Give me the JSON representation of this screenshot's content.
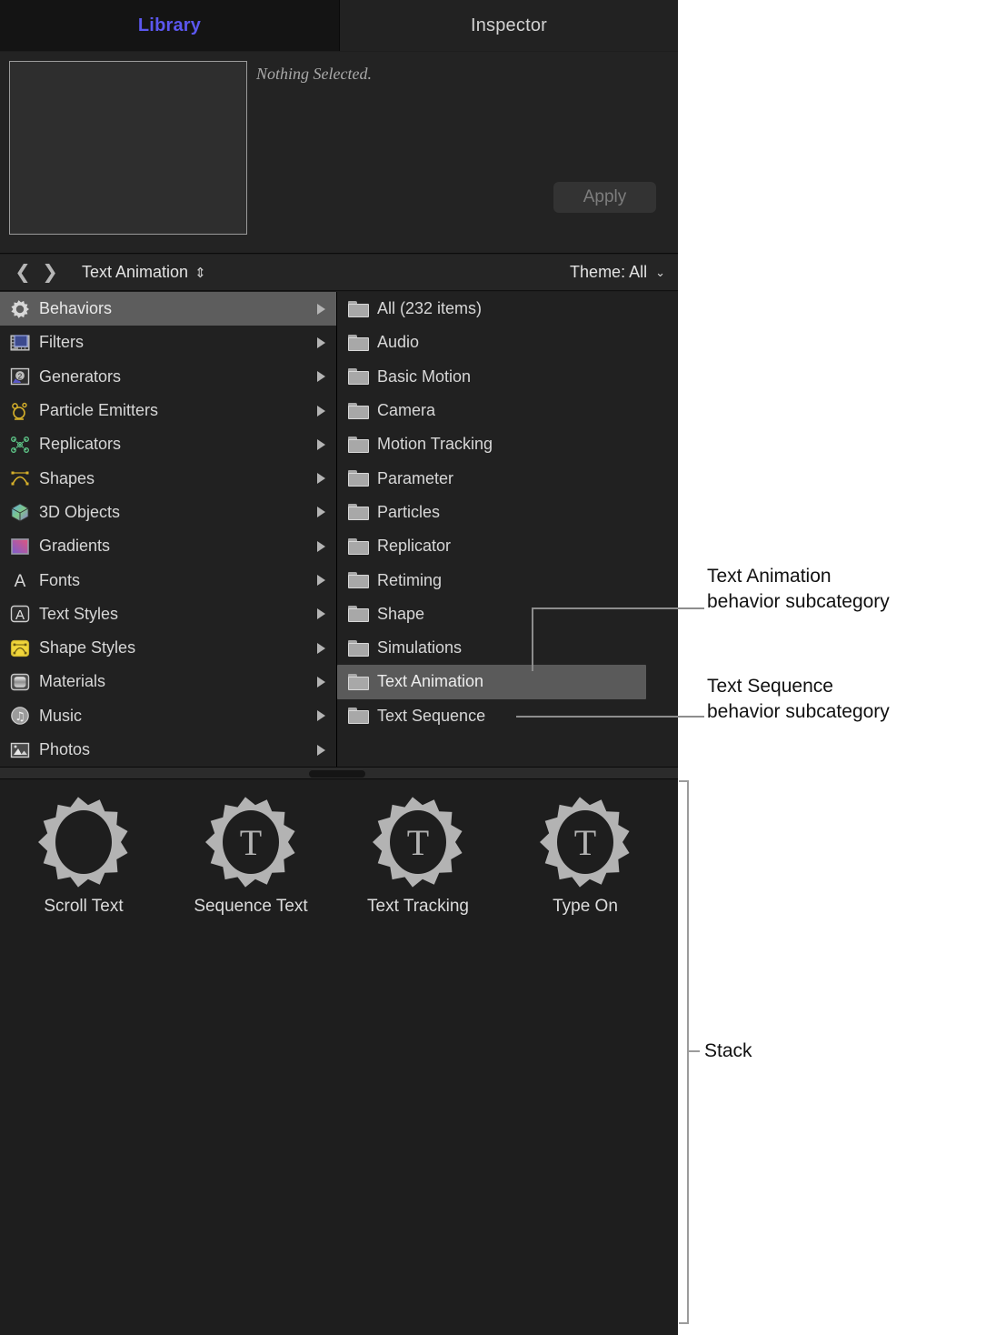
{
  "app": {
    "tabs": [
      {
        "label": "Library",
        "active": true
      },
      {
        "label": "Inspector",
        "active": false
      }
    ]
  },
  "preview": {
    "status_text": "Nothing Selected.",
    "apply_label": "Apply"
  },
  "pathbar": {
    "back_icon": "chevron-left-icon",
    "forward_icon": "chevron-right-icon",
    "title": "Text Animation",
    "sort_glyph": "⇕",
    "theme_label": "Theme: All",
    "theme_chevron": "⌄"
  },
  "categories": [
    {
      "label": "Behaviors",
      "icon": "gear-icon",
      "selected": true
    },
    {
      "label": "Filters",
      "icon": "film-strip-icon",
      "selected": false
    },
    {
      "label": "Generators",
      "icon": "generator-icon",
      "selected": false
    },
    {
      "label": "Particle Emitters",
      "icon": "particle-emitter-icon",
      "selected": false
    },
    {
      "label": "Replicators",
      "icon": "replicator-icon",
      "selected": false
    },
    {
      "label": "Shapes",
      "icon": "shape-curve-icon",
      "selected": false
    },
    {
      "label": "3D Objects",
      "icon": "cube-icon",
      "selected": false
    },
    {
      "label": "Gradients",
      "icon": "gradient-swatch-icon",
      "selected": false
    },
    {
      "label": "Fonts",
      "icon": "letter-a-icon",
      "selected": false
    },
    {
      "label": "Text Styles",
      "icon": "text-style-icon",
      "selected": false
    },
    {
      "label": "Shape Styles",
      "icon": "shape-style-icon",
      "selected": false
    },
    {
      "label": "Materials",
      "icon": "material-icon",
      "selected": false
    },
    {
      "label": "Music",
      "icon": "music-note-icon",
      "selected": false
    },
    {
      "label": "Photos",
      "icon": "photo-icon",
      "selected": false
    }
  ],
  "subcategories": [
    {
      "label": "All (232 items)",
      "selected": false
    },
    {
      "label": "Audio",
      "selected": false
    },
    {
      "label": "Basic Motion",
      "selected": false
    },
    {
      "label": "Camera",
      "selected": false
    },
    {
      "label": "Motion Tracking",
      "selected": false
    },
    {
      "label": "Parameter",
      "selected": false
    },
    {
      "label": "Particles",
      "selected": false
    },
    {
      "label": "Replicator",
      "selected": false
    },
    {
      "label": "Retiming",
      "selected": false
    },
    {
      "label": "Shape",
      "selected": false
    },
    {
      "label": "Simulations",
      "selected": false
    },
    {
      "label": "Text Animation",
      "selected": true
    },
    {
      "label": "Text Sequence",
      "selected": false
    }
  ],
  "stack": {
    "items": [
      {
        "label": "Scroll Text",
        "icon": "gear-icon",
        "glyph": ""
      },
      {
        "label": "Sequence Text",
        "icon": "gear-text-icon",
        "glyph": "T"
      },
      {
        "label": "Text Tracking",
        "icon": "gear-text-icon",
        "glyph": "T"
      },
      {
        "label": "Type On",
        "icon": "gear-text-icon",
        "glyph": "T"
      }
    ]
  },
  "annotations": [
    {
      "line1": "Text Animation",
      "line2": "behavior subcategory"
    },
    {
      "line1": "Text Sequence",
      "line2": "behavior subcategory"
    },
    {
      "line1": "Stack",
      "line2": ""
    }
  ],
  "colors": {
    "panel_bg": "#1e1e1e",
    "accent_tab": "#5b57ef",
    "selection_gray": "#5a5a5a",
    "gear_gray": "#b3b3b3",
    "leader_line": "#8d8d8d"
  }
}
